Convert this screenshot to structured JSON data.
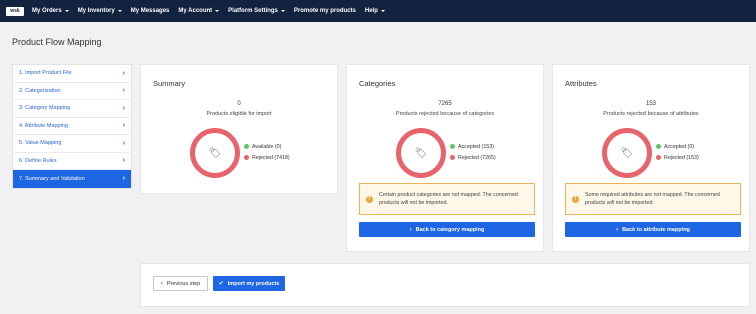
{
  "nav": {
    "logo": "wsk",
    "items": [
      {
        "label": "My Orders",
        "caret": true
      },
      {
        "label": "My Inventory",
        "caret": true
      },
      {
        "label": "My Messages",
        "caret": false
      },
      {
        "label": "My Account",
        "caret": true
      },
      {
        "label": "Platform Settings",
        "caret": true
      },
      {
        "label": "Promote my products",
        "caret": false
      },
      {
        "label": "Help",
        "caret": true
      }
    ]
  },
  "page": {
    "title": "Product Flow Mapping"
  },
  "steps": [
    {
      "label": "1. Import Product File",
      "active": false
    },
    {
      "label": "2. Categorization",
      "active": false
    },
    {
      "label": "3. Category Mapping",
      "active": false
    },
    {
      "label": "4. Attribute Mapping",
      "active": false
    },
    {
      "label": "5. Value Mapping",
      "active": false
    },
    {
      "label": "6. Define Rules",
      "active": false
    },
    {
      "label": "7. Summary and Validation",
      "active": true
    }
  ],
  "summary": {
    "title": "Summary",
    "count": "0",
    "count_label": "Products eligible for import",
    "legend": [
      {
        "label": "Available (0)",
        "color": "#5ec46a"
      },
      {
        "label": "Rejected (7418)",
        "color": "#e8646d"
      }
    ]
  },
  "categories": {
    "title": "Categories",
    "count": "7265",
    "count_label": "Products rejected because of categories",
    "legend": [
      {
        "label": "Accepted (153)",
        "color": "#5ec46a"
      },
      {
        "label": "Rejected (7265)",
        "color": "#e8646d"
      }
    ],
    "warning_line1": "Certain product categories are not mapped. The concerned",
    "warning_line2": "products will not be imported.",
    "button": "Back to category mapping"
  },
  "attributes": {
    "title": "Attributes",
    "count": "153",
    "count_label": "Products rejected because of attributes",
    "legend": [
      {
        "label": "Accepted (0)",
        "color": "#5ec46a"
      },
      {
        "label": "Rejected (153)",
        "color": "#e8646d"
      }
    ],
    "warning_line1": "Some required attributes are not mapped. The concerned",
    "warning_line2": "products will not be imported.",
    "button": "Back to attribute mapping"
  },
  "actions": {
    "previous": "Previous step",
    "import": "Import my products"
  }
}
